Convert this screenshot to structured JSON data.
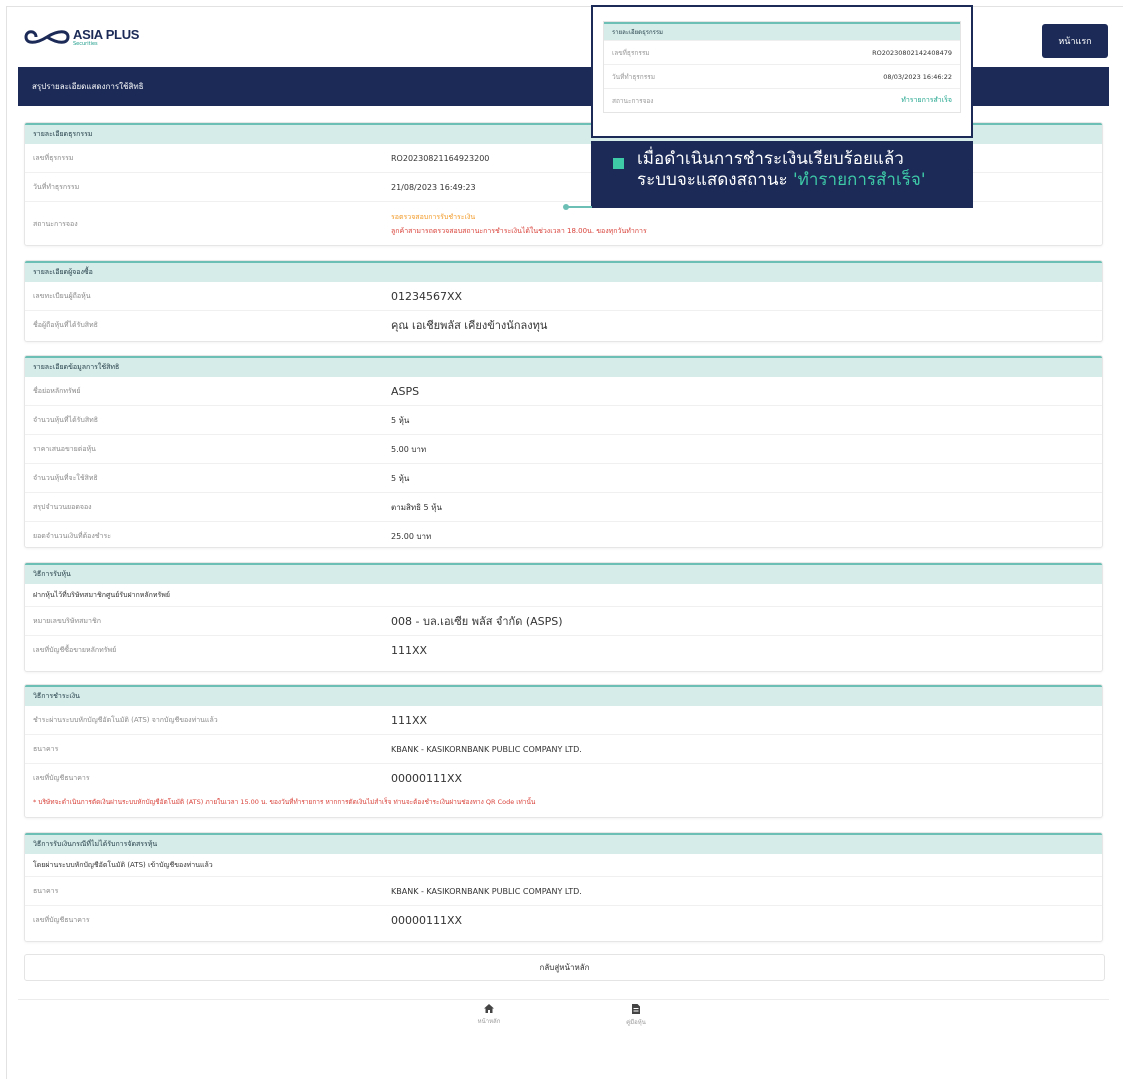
{
  "header": {
    "logo_text": "ASIA PLUS",
    "logo_sub": "Securities",
    "home_button": "หน้าแรก",
    "title": "สรุปรายละเอียดแสดงการใช้สิทธิ"
  },
  "transaction": {
    "title": "รายละเอียดธุรกรรม",
    "rows": [
      {
        "label": "เลขที่ธุรกรรม",
        "value": "RO20230821164923200"
      },
      {
        "label": "วันที่ทำธุรกรรม",
        "value": "21/08/2023 16:49:23"
      }
    ],
    "status_label": "สถานะการจอง",
    "status_value": "รอตรวจสอบการรับชำระเงิน",
    "status_note": "ลูกค้าสามารถตรวจสอบสถานะการชำระเงินได้ในช่วงเวลา 18.00น. ของทุกวันทำการ"
  },
  "buyer": {
    "title": "รายละเอียดผู้จองซื้อ",
    "rows": [
      {
        "label": "เลขทะเบียนผู้ถือหุ้น",
        "value": "01234567XX"
      },
      {
        "label": "ชื่อผู้ถือหุ้นที่ได้รับสิทธิ",
        "value": "คุณ เอเชียพลัส เคียงข้างนักลงทุน"
      }
    ]
  },
  "rights": {
    "title": "รายละเอียดข้อมูลการใช้สิทธิ",
    "rows": [
      {
        "label": "ชื่อย่อหลักทรัพย์",
        "value": "ASPS"
      },
      {
        "label": "จำนวนหุ้นที่ได้รับสิทธิ",
        "value": "5 หุ้น"
      },
      {
        "label": "ราคาเสนอขายต่อหุ้น",
        "value": "5.00 บาท"
      },
      {
        "label": "จำนวนหุ้นที่จะใช้สิทธิ",
        "value": "5 หุ้น"
      },
      {
        "label": "สรุปจำนวนยอดจอง",
        "value": "ตามสิทธิ 5 หุ้น"
      },
      {
        "label": "ยอดจำนวนเงินที่ต้องชำระ",
        "value": "25.00 บาท"
      }
    ]
  },
  "receive": {
    "title": "วิธีการรับหุ้น",
    "subtitle": "ฝากหุ้นไว้ที่บริษัทสมาชิกศูนย์รับฝากหลักทรัพย์",
    "rows": [
      {
        "label": "หมายเลขบริษัทสมาชิก",
        "value": "008 - บล.เอเซีย พลัส จำกัด (ASPS)"
      },
      {
        "label": "เลขที่บัญชีซื้อขายหลักทรัพย์",
        "value": "111XX"
      }
    ]
  },
  "payment": {
    "title": "วิธีการชำระเงิน",
    "rows": [
      {
        "label": "ชำระผ่านระบบหักบัญชีอัตโนมัติ (ATS) จากบัญชีของท่านแล้ว",
        "value": "111XX"
      },
      {
        "label": "ธนาคาร",
        "value": "KBANK - KASIKORNBANK PUBLIC COMPANY LTD."
      },
      {
        "label": "เลขที่บัญชีธนาคาร",
        "value": "00000111XX"
      }
    ],
    "note": "* บริษัทจะดำเนินการตัดเงินผ่านระบบหักบัญชีอัตโนมัติ (ATS) ภายในเวลา 15.00 น. ของวันที่ทำรายการ หากการตัดเงินไม่สำเร็จ ท่านจะต้องชำระเงินผ่านช่องทาง QR Code เท่านั้น"
  },
  "refund": {
    "title": "วิธีการรับเงินกรณีที่ไม่ได้รับการจัดสรรหุ้น",
    "subtitle": "โดยผ่านระบบหักบัญชีอัตโนมัติ (ATS) เข้าบัญชีของท่านแล้ว",
    "rows": [
      {
        "label": "ธนาคาร",
        "value": "KBANK - KASIKORNBANK PUBLIC COMPANY LTD."
      },
      {
        "label": "เลขที่บัญชีธนาคาร",
        "value": "00000111XX"
      }
    ]
  },
  "back_button": "กลับสู่หน้าหลัก",
  "nav": {
    "home": "หน้าหลัก",
    "docs": "คู่มือหุ้น"
  },
  "popup": {
    "title": "รายละเอียดธุรกรรม",
    "rows": [
      {
        "label": "เลขที่ธุรกรรม",
        "value": "RO20230802142408479"
      },
      {
        "label": "วันที่ทำธุรกรรม",
        "value": "08/03/2023 16:46:22"
      },
      {
        "label": "สถานะการจอง",
        "value": "ทำรายการสำเร็จ"
      }
    ]
  },
  "callout": {
    "line1": "เมื่อดำเนินการชำระเงินเรียบร้อยแล้ว",
    "line2_prefix": "ระบบจะแสดงสถานะ",
    "line2_highlight": "'ทำรายการสำเร็จ'"
  },
  "colors": {
    "navy": "#1b2a57",
    "teal": "#6cbfb4",
    "teal_light": "#d6ece9",
    "green": "#3ec9a7",
    "orange": "#f29b29",
    "red": "#d9433b"
  }
}
